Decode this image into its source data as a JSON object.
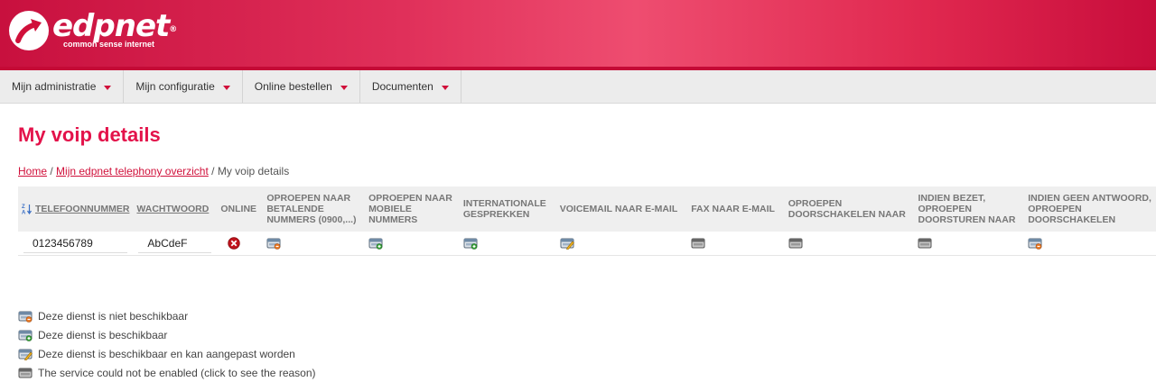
{
  "brand": {
    "name": "edpnet",
    "reg": "®",
    "tagline": "common sense internet"
  },
  "nav": [
    {
      "label": "Mijn administratie"
    },
    {
      "label": "Mijn configuratie"
    },
    {
      "label": "Online bestellen"
    },
    {
      "label": "Documenten"
    }
  ],
  "page": {
    "title": "My voip details"
  },
  "breadcrumb": {
    "home": "Home",
    "sep1": " / ",
    "overview": "Mijn edpnet telephony overzicht",
    "sep2": " / ",
    "current": "My voip details"
  },
  "table": {
    "headers": {
      "phone": "Telefoonnummer",
      "password": "Wachtwoord",
      "online": "Online",
      "paid": "Oproepen naar betalende nummers (0900,...)",
      "mobile": "Oproepen naar mobiele nummers",
      "intl": "Internationale gesprekken",
      "voicemail": "Voicemail naar e-mail",
      "fax": "Fax naar e-mail",
      "forward": "Oproepen doorschakelen naar",
      "busy": "Indien bezet, oproepen doorsturen naar",
      "noanswer": "Indien geen antwoord, oproepen doorschakelen"
    },
    "rows": [
      {
        "phone": "0123456789",
        "password": "AbCdeF",
        "online": "offline-icon",
        "paid": "unavailable",
        "mobile": "available",
        "intl": "available",
        "voicemail": "editable",
        "fax": "not-enabled",
        "forward": "not-enabled",
        "busy": "not-enabled",
        "noanswer": "unavailable"
      }
    ]
  },
  "legend": [
    {
      "status": "unavailable",
      "label": "Deze dienst is niet beschikbaar"
    },
    {
      "status": "available",
      "label": "Deze dienst is beschikbaar"
    },
    {
      "status": "editable",
      "label": "Deze dienst is beschikbaar en kan aangepast worden"
    },
    {
      "status": "not-enabled",
      "label": "The service could not be enabled (click to see the reason)"
    }
  ],
  "colors": {
    "brand": "#d0103a",
    "title": "#e3124a"
  }
}
